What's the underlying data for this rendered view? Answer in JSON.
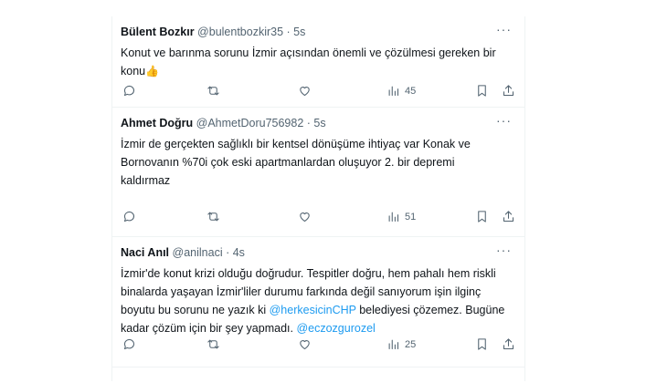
{
  "tweets": [
    {
      "name": "Bülent Bozkır",
      "handle": "@bulentbozkir35 · 5s",
      "line1": "Konut ve barınma sorunu İzmir açısından önemli ve çözülmesi gereken bir",
      "line2": "konu",
      "emoji": "👍",
      "views": "45"
    },
    {
      "name": "Ahmet Doğru",
      "handle": "@AhmetDoru756982 · 5s",
      "line1": "İzmir de gerçekten sağlıklı bir kentsel dönüşüme ihtiyaç var Konak ve",
      "line2": "Bornovanın %70i çok eski apartmanlardan oluşuyor 2. bir depremi",
      "line3": "kaldırmaz",
      "views": "51"
    },
    {
      "name": "Naci Anıl",
      "handle": "@anilnaci · 4s",
      "line1": "İzmir'de konut krizi olduğu doğrudur. Tespitler doğru, hem pahalı hem riskli",
      "line2": "binalarda yaşayan İzmir'liler durumu farkında değil sanıyorum işin ilginç",
      "line3a": "boyutu bu sorunu ne yazık ki ",
      "mention1": "@herkesicinCHP",
      "line3b": " belediyesi çözemez. Bugüne",
      "line4a": "kadar çözüm için bir şey yapmadı. ",
      "mention2": "@eczozgurozel",
      "views": "25"
    }
  ],
  "more_label": "···"
}
